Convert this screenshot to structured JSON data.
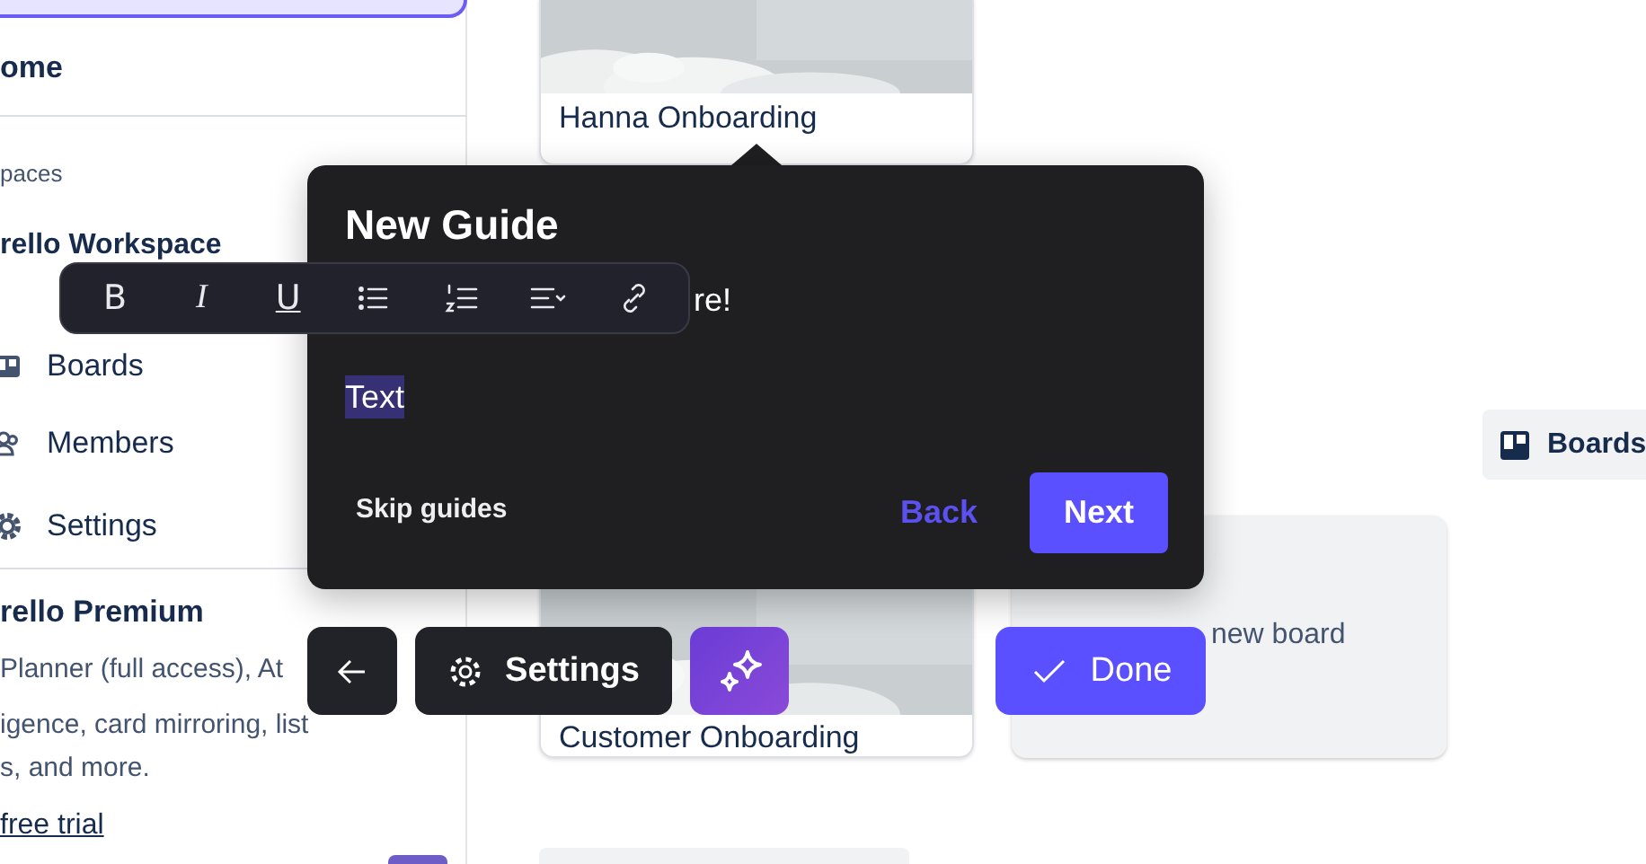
{
  "sidebar": {
    "home": "ome",
    "section_label": "paces",
    "workspace": "rello Workspace",
    "items": [
      {
        "kind": "boards",
        "label": "Boards"
      },
      {
        "kind": "members",
        "label": "Members"
      },
      {
        "kind": "settings",
        "label": "Settings"
      }
    ],
    "premium": {
      "title": "rello Premium",
      "lines": [
        "Planner (full access), At",
        "igence, card mirroring, list",
        "s, and more."
      ],
      "link": "free trial"
    }
  },
  "board_cards": {
    "top_card": {
      "title": "Hanna Onboarding"
    },
    "bottom_card": {
      "title": "Customer Onboarding"
    },
    "create_card": {
      "label": "new board"
    },
    "boards_chip": {
      "label": "Boards"
    }
  },
  "guide": {
    "title": "New Guide",
    "body_fragment": "re!",
    "selected_text": "Text",
    "skip": "Skip guides",
    "back": "Back",
    "next": "Next"
  },
  "format_toolbar": {
    "tools": [
      {
        "kind": "bold",
        "glyph": "B"
      },
      {
        "kind": "italic",
        "glyph": "I"
      },
      {
        "kind": "underline",
        "glyph": "U"
      },
      {
        "kind": "bullet-list"
      },
      {
        "kind": "numbered-list"
      },
      {
        "kind": "align"
      },
      {
        "kind": "link"
      }
    ]
  },
  "action_bar": {
    "buttons": [
      {
        "kind": "back"
      },
      {
        "kind": "settings",
        "label": "Settings"
      },
      {
        "kind": "ai"
      },
      {
        "kind": "done",
        "label": "Done"
      }
    ]
  }
}
